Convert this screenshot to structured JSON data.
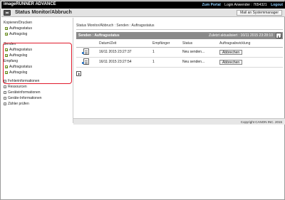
{
  "topbar": {
    "brand": "imageRUNNER ADVANCE",
    "portal_link": "Zum Portal",
    "login_label": "Login Anwender : 7654321",
    "logout_link": "Logout"
  },
  "header": {
    "title": "Status Monitor/Abbruch",
    "mail_button": "Mail an Systemmanager"
  },
  "sidebar": {
    "groups": [
      {
        "label": "Kopieren/Drucken",
        "items": [
          "Auftragsstatus",
          "Auftragslog"
        ]
      },
      {
        "label": "Senden",
        "items": [
          "Auftragsstatus",
          "Auftragslog"
        ]
      },
      {
        "label": "Empfang",
        "items": [
          "Auftragsstatus",
          "Auftragslog"
        ]
      }
    ],
    "top_items": [
      "Fehlerinformationen",
      "Ressourcen",
      "Geräteinformationen",
      "Geräte-Informationen",
      "Zähler prüfen"
    ]
  },
  "main": {
    "breadcrumb": "Status Monitor/Abbruch : Senden : Auftragsstatus",
    "section_title": "Senden : Auftragsstatus",
    "last_updated": "Zuletzt aktualisiert : 16/11 2015 23:28:10",
    "columns": [
      "",
      "Datum/Zeit",
      "Empfänger",
      "Status",
      "Auftragsabwicklung"
    ],
    "rows": [
      {
        "datetime": "16/11 2015 23:27:37",
        "recipients": "1",
        "status": "Neu senden...",
        "action": "Abbrechen"
      },
      {
        "datetime": "16/11 2015 23:27:54",
        "recipients": "1",
        "status": "Neu senden...",
        "action": "Abbrechen"
      }
    ]
  },
  "footer": {
    "copyright": "Copyright CANON INC. 2015"
  },
  "colors": {
    "topbar": "#000000",
    "highlight": "#e01b2c",
    "titlebar": "#8a8a8a"
  }
}
